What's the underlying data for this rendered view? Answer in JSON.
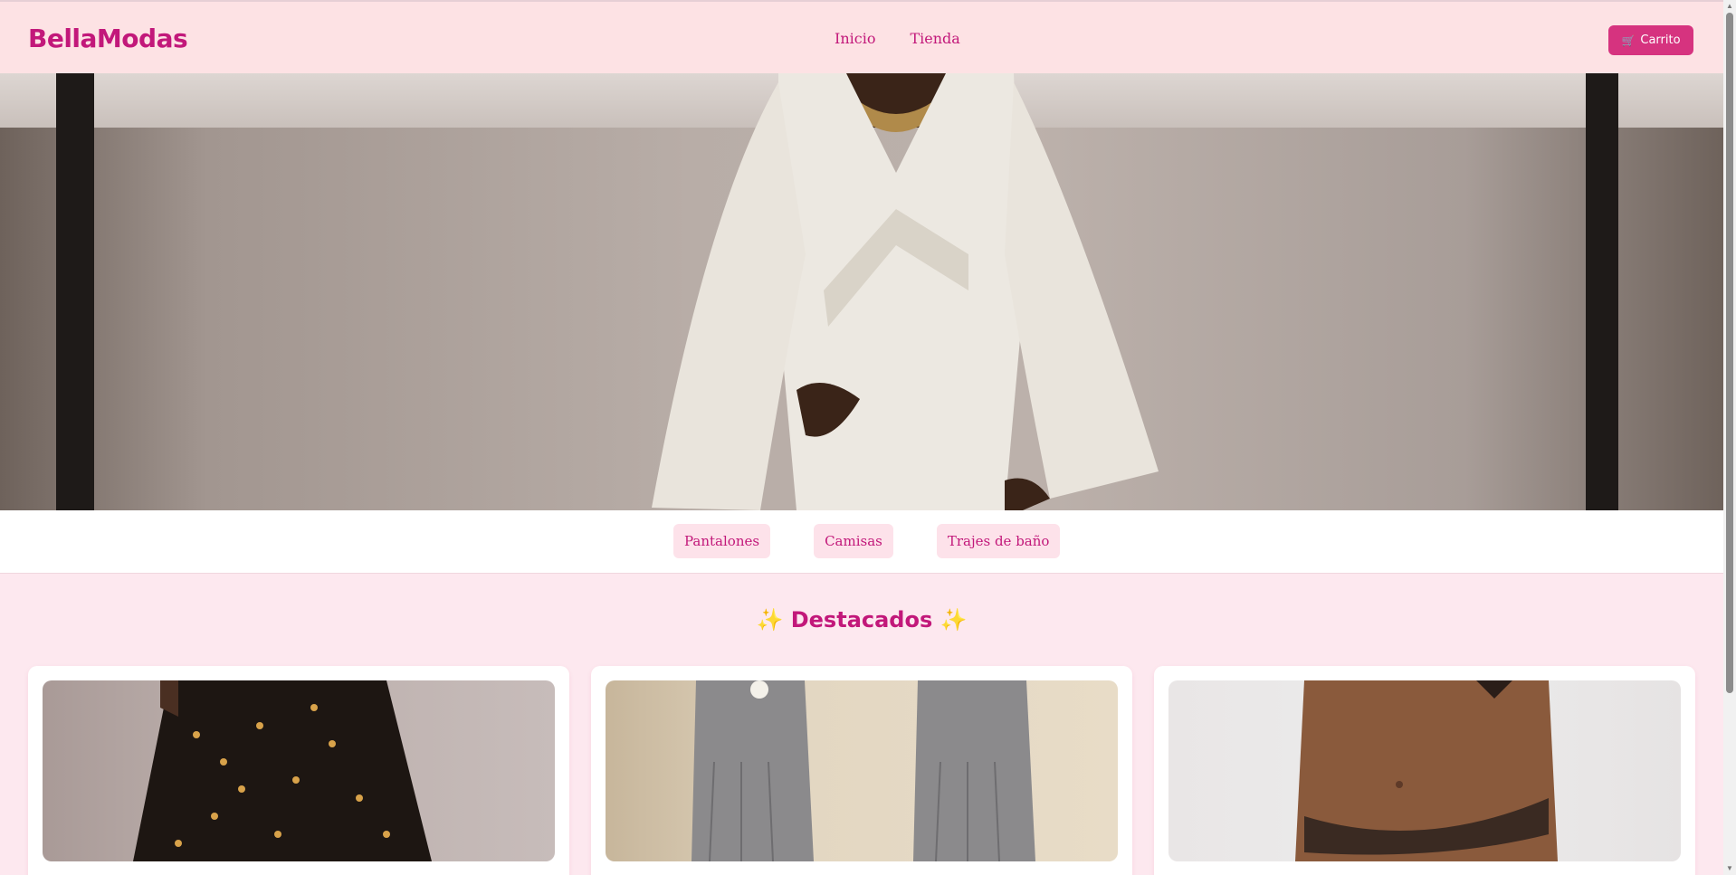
{
  "header": {
    "logo": "BellaModas",
    "nav": [
      {
        "label": "Inicio"
      },
      {
        "label": "Tienda"
      }
    ],
    "cart": {
      "label": "Carrito",
      "icon": "cart-icon"
    }
  },
  "categories": [
    {
      "label": "Pantalones"
    },
    {
      "label": "Camisas"
    },
    {
      "label": "Trajes de baño"
    }
  ],
  "featured": {
    "title": "Destacados",
    "spark": "✨"
  },
  "colors": {
    "brand": "#c2187a",
    "header_bg": "#fde2e4",
    "button_bg": "#d6337f",
    "page_bg": "#fde8ef"
  }
}
